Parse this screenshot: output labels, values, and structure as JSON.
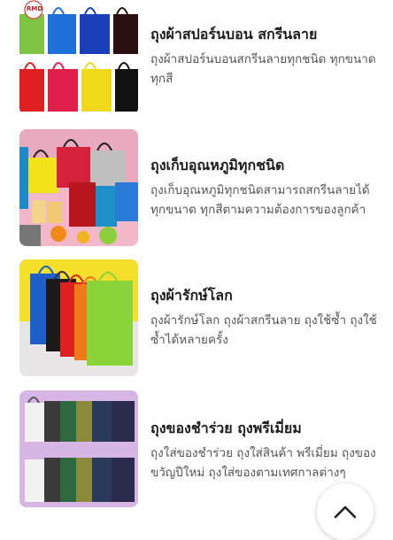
{
  "products": [
    {
      "title": "ถุงผ้าสปอร์นบอน สกรีนลาย",
      "description": "ถุงผ้าสปอร์นบอนสกรีนลายทุกชนิด ทุกขนาด ทุกสี",
      "image_icon": "colored-tote-bags-grid",
      "badge": "RMD"
    },
    {
      "title": "ถุงเก็บอุณหภูมิทุกชนิด",
      "description": "ถุงเก็บอุณหภูมิทุกชนิดสามารถสกรีนลายได้ ทุกขนาด ทุกสีตามความต้องการของลูกค้า",
      "image_icon": "insulated-bags-with-drinks"
    },
    {
      "title": "ถุงผ้ารักษ์โลก",
      "description": "ถุงผ้ารักษ์โลก ถุงผ้าสกรีนลาย ถุงใช้ซ้ำ ถุงใช้ซ้ำได้หลายครั้ง",
      "image_icon": "eco-tote-bags-fan"
    },
    {
      "title": "ถุงของชำร่วย ถุงพรีเมี่ยม",
      "description": "ถุงใส่ของชำร่วย ถุงใส่สินค้า พรีเมี่ยม ถุงของขวัญปีใหม่ ถุงใส่ของตามเทศกาลต่างๆ",
      "image_icon": "premium-gift-bags-rows"
    }
  ],
  "scroll_top": {
    "icon": "chevron-up-icon"
  }
}
